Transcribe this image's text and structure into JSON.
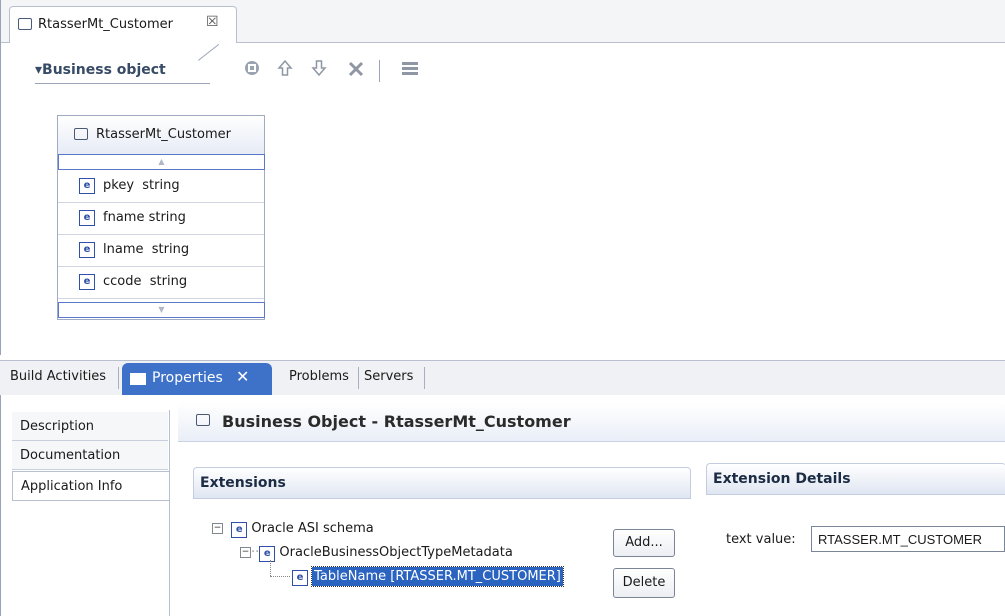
{
  "editor": {
    "tab_title": "RtasserMt_Customer",
    "tab_close": "☒",
    "section_title": "▾Business object",
    "toolbar": {
      "icons": [
        "add-attribute-icon",
        "move-up-icon",
        "move-down-icon",
        "delete-icon",
        "layout-icon"
      ]
    },
    "bo": {
      "title": "RtasserMt_Customer",
      "attributes": [
        {
          "name": "pkey",
          "type": "string"
        },
        {
          "name": "fname",
          "type": "string"
        },
        {
          "name": "lname",
          "type": "string"
        },
        {
          "name": "ccode",
          "type": "string"
        }
      ]
    }
  },
  "views": {
    "tabs": [
      "Build Activities",
      "Properties",
      "Problems",
      "Servers"
    ],
    "active_tab": "Properties"
  },
  "properties": {
    "nav": [
      "Description",
      "Documentation",
      "Application Info"
    ],
    "selected_nav": "Application Info",
    "header": "Business Object - RtasserMt_Customer",
    "extensions": {
      "title": "Extensions",
      "tree": [
        {
          "label": "Oracle ASI schema",
          "expander": "−"
        },
        {
          "label": "OracleBusinessObjectTypeMetadata",
          "expander": "−"
        },
        {
          "label": "TableName [RTASSER.MT_CUSTOMER]"
        }
      ],
      "add_label": "Add...",
      "delete_label": "Delete"
    },
    "details": {
      "title": "Extension Details",
      "field_label": "text value:",
      "field_value": "RTASSER.MT_CUSTOMER"
    }
  },
  "colors": {
    "accent": "#3e72c8",
    "selection": "#2a63c0"
  }
}
